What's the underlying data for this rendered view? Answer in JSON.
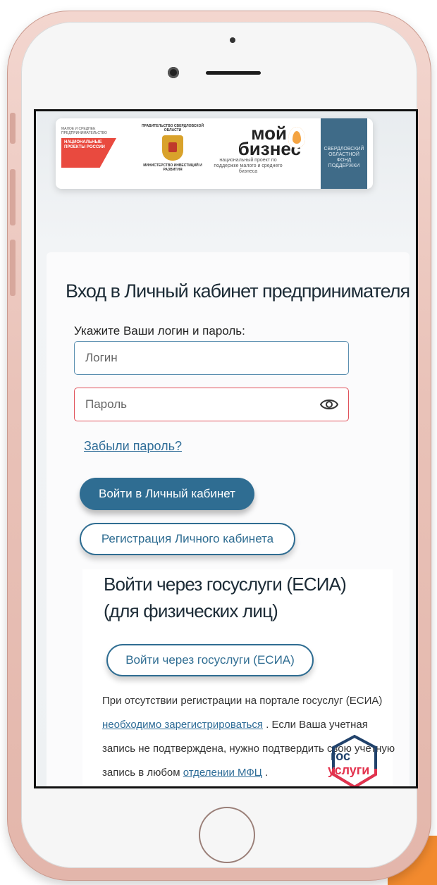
{
  "logos": {
    "np_small": "МАЛОЕ И СРЕДНЕЕ ПРЕДПРИНИМАТЕЛЬСТВО",
    "np_red": "НАЦИОНАЛЬНЫЕ ПРОЕКТЫ РОССИИ",
    "gov_top": "ПРАВИТЕЛЬСТВО СВЕРДЛОВСКОЙ ОБЛАСТИ",
    "gov_bottom": "МИНИСТЕРСТВО ИНВЕСТИЦИЙ И РАЗВИТИЯ",
    "mb_title_1": "мой",
    "mb_title_2": "бизнес",
    "mb_sub": "национальный проект по поддержке малого и среднего бизнеса",
    "fund": "СВЕРДЛОВСКИЙ ОБЛАСТНОЙ ФОНД ПОДДЕРЖКИ"
  },
  "login": {
    "title": "Вход в Личный кабинет предпринимателя",
    "hint": "Укажите Ваши логин и пароль:",
    "login_placeholder": "Логин",
    "password_placeholder": "Пароль",
    "forgot": "Забыли пароль?",
    "submit": "Войти в Личный кабинет",
    "register": "Регистрация Личного кабинета"
  },
  "gosuslugi": {
    "title_line1": "Войти через госуслуги (ЕСИА)",
    "title_line2": "(для физических лиц)",
    "button": "Войти через госуслуги (ЕСИА)",
    "info_1": "При отсутствии регистрации на портале госуслуг (ЕСИА)",
    "info_link1": "необходимо зарегистрироваться",
    "info_2": ". Если Ваша учетная запись не подтверждена, нужно подтвердить свою учетную запись в любом",
    "info_link2": "отделении МФЦ",
    "info_3": ".",
    "logo_top": "гос",
    "logo_bottom": "услуги"
  }
}
